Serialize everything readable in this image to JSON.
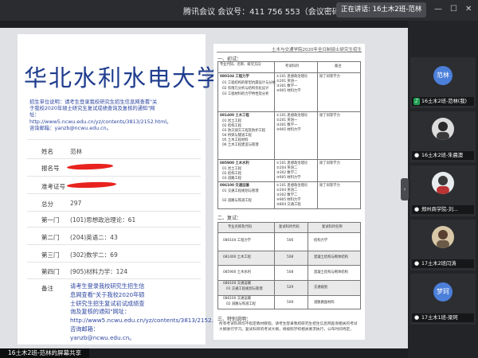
{
  "window": {
    "title": "腾讯会议 会议号：411 756 553（会议密码：123456）",
    "speaking": "正在讲话: 16土木2班-范林",
    "minimize_icon": "minus-icon",
    "maximize_icon": "square-icon",
    "close_icon": "close-icon"
  },
  "slide": {
    "school": "华北水利水电大学",
    "notice": "招生单位说明：请考生登录我校研究生招生信息网查看\"关于我校2020年硕士研究生复试成绩查询及复核的通知\"网址：http://www5.ncwu.edu.cn/yz/contents/3813/2152.html。咨询邮箱：yanzb@ncwu.edu.cn。",
    "fields": [
      {
        "label": "姓名",
        "value": "范林"
      },
      {
        "label": "报名号",
        "value": ""
      },
      {
        "label": "准考证号",
        "value": ""
      },
      {
        "label": "总分",
        "value": "297"
      },
      {
        "label": "第一门",
        "value": "(101)思想政治理论：61"
      },
      {
        "label": "第二门",
        "value": "(204)英语二：43"
      },
      {
        "label": "第三门",
        "value": "(302)数学二：69"
      },
      {
        "label": "第四门",
        "value": "(905)材料力学：124"
      }
    ],
    "remark_label": "备注",
    "remark_value": "请考生登录我校研究生招生信息网查看\"关于我校2020年硕士研究生招生复试初试成绩查询及复核的通知\"网址：http://www5.ncwu.edu.cn/yz/contents/3813/2152.html。咨询邮箱：yanzb@ncwu.edu.cn。"
  },
  "doc": {
    "header": "土木与交通学院2020年全日制硕士研究生招生",
    "section1": "一、初试：",
    "section2": "二、复试：",
    "section3": "三、特别说明：",
    "t1_headers": [
      "专业代码、名称、研究方向",
      "考试科目",
      "备注"
    ],
    "t1_rows": [
      {
        "name": "080104 工程力学",
        "dirs": [
          "01 工程结构的新型抗震设计与分析",
          "02 有限元分析与结构优化设计",
          "03 工程材料的力学特性及分析"
        ],
        "subjects": [
          "①101 思想政治理论",
          "②201 英语一",
          "③301 数学一",
          "④905 材料力学"
        ],
        "note": "除了同等学力"
      },
      {
        "name": "081400 土木工程",
        "dirs": [
          "01 岩土工程",
          "02 结构工程",
          "03 防灾减灾工程及防护工程",
          "04 桥梁与隧道工程",
          "05 土木工程材料",
          "06 土木工程建造与管理"
        ],
        "subjects": [
          "①101 思想政治理论",
          "②201 英语一",
          "③301 数学一",
          "④905 材料力学"
        ],
        "note": "除了同等学力"
      },
      {
        "name": "085900 土木水利",
        "dirs": [
          "01 岩土工程",
          "02 结构工程",
          "03 道路工程"
        ],
        "subjects": [
          "①101 思想政治理论",
          "②204 英语二",
          "③302 数学二",
          "④905 材料力学"
        ],
        "note": "除了同等学力"
      },
      {
        "name": "086100 交通运输",
        "dirs": [
          "01 交通工程规划与管理",
          "",
          "02 道路与铁道工程"
        ],
        "subjects": [
          "①101 思想政治理论",
          "②204 英语二",
          "③302 数学二",
          "④905 材料力学",
          "⑤804 交通工程"
        ],
        "note": "除了同等学力"
      }
    ],
    "t2_headers": [
      "专业名称及代码",
      "复试科目代码",
      "复试科目名称"
    ],
    "t2_rows": [
      {
        "name": "080104 工程力学",
        "code": "506",
        "subject": "结构力学"
      },
      {
        "name": "081400 土木工程",
        "code": "508",
        "subject": "混凝土结构与砌体结构"
      },
      {
        "name": "085900 土木水利",
        "code": "508",
        "subject": "混凝土结构与砌体结构"
      },
      {
        "name": "086100 交通运输",
        "sub": "01 交通工程规划与管理",
        "code": "529",
        "subject": "交通规划"
      },
      {
        "name": "086100 交通运输",
        "sub": "02 道路与铁道工程",
        "code": "509",
        "subject": "道路路面材料"
      }
    ],
    "note": "所有考试科目均不指定教材教程。请考生登录我校研究生招生信息网查询相关的考试大纲进行学习。复试科目的考试大纲，将按照学校相关要求执行，公布时间待定。"
  },
  "participants": [
    {
      "name": "16土木2班-范林(我)",
      "initials": "范林",
      "avatar_color": "#4b7fd9",
      "type": "circle",
      "mic_icon": "mic-speaking-icon"
    },
    {
      "name": "16土木2班-朱晨澳",
      "type": "photo",
      "mic_icon": "mic-icon"
    },
    {
      "name": "郑州商学院-刘...",
      "type": "photo",
      "mic_icon": "mic-icon"
    },
    {
      "name": "17土木2班闫涛",
      "type": "photo",
      "mic_icon": "mic-icon"
    },
    {
      "name": "17土木1班-梁珂",
      "initials": "梦珂",
      "avatar_color": "#4b7fd9",
      "type": "circle",
      "mic_icon": "mic-icon"
    }
  ],
  "bottom_label": "16土木2班-范林的屏幕共享",
  "colors": {
    "accent": "#4b7fd9",
    "school_title": "#1f3d8e",
    "redaction": "#e8231f",
    "link_text": "#2d46a0"
  }
}
